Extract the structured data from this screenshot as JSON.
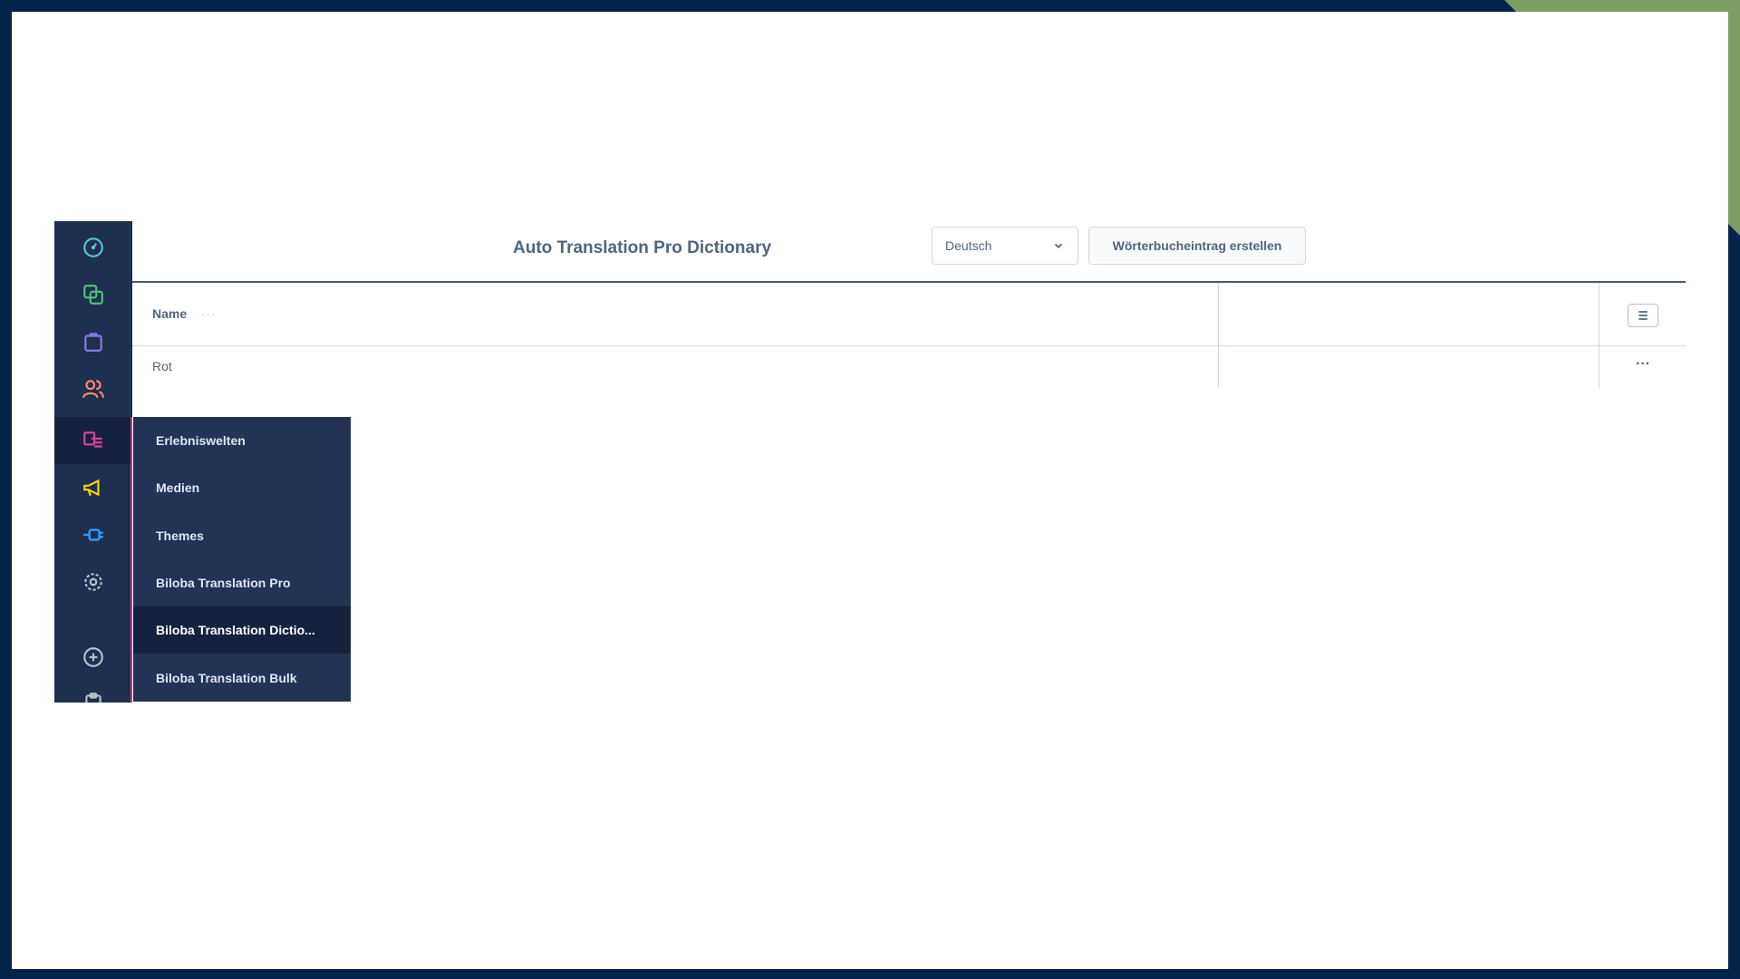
{
  "theme": {
    "frame": "#03244a",
    "accent_green": "#7d9c63",
    "sidebar_bg": "#1e2f4f",
    "flyout_bg": "#223355",
    "active_magenta": "#d62f8f"
  },
  "sidebar": {
    "icons": [
      {
        "name": "dashboard-icon",
        "color": "#5bc0de"
      },
      {
        "name": "catalog-icon",
        "color": "#4ec07a"
      },
      {
        "name": "orders-icon",
        "color": "#8b78e6"
      },
      {
        "name": "customers-icon",
        "color": "#ff8a65"
      },
      {
        "name": "content-icon",
        "color": "#e040a0",
        "active": true
      },
      {
        "name": "marketing-icon",
        "color": "#ffd400"
      },
      {
        "name": "extensions-icon",
        "color": "#2e9bff"
      },
      {
        "name": "settings-icon",
        "color": "#b6c1cc"
      },
      {
        "name": "add-icon",
        "color": "#b6c1cc"
      },
      {
        "name": "clipboard-icon",
        "color": "#b6c1cc"
      }
    ]
  },
  "header": {
    "title": "Auto Translation Pro Dictionary",
    "language_value": "Deutsch",
    "create_button": "Wörterbucheintrag erstellen"
  },
  "table": {
    "column_name": "Name",
    "column_dots": "···",
    "rows": [
      {
        "name": "Rot",
        "actions": "···"
      }
    ]
  },
  "flyout": {
    "items": [
      {
        "label": "Erlebniswelten"
      },
      {
        "label": "Medien"
      },
      {
        "label": "Themes"
      },
      {
        "label": "Biloba Translation Pro"
      },
      {
        "label": "Biloba Translation Dictio...",
        "active": true
      },
      {
        "label": "Biloba Translation Bulk"
      }
    ]
  }
}
